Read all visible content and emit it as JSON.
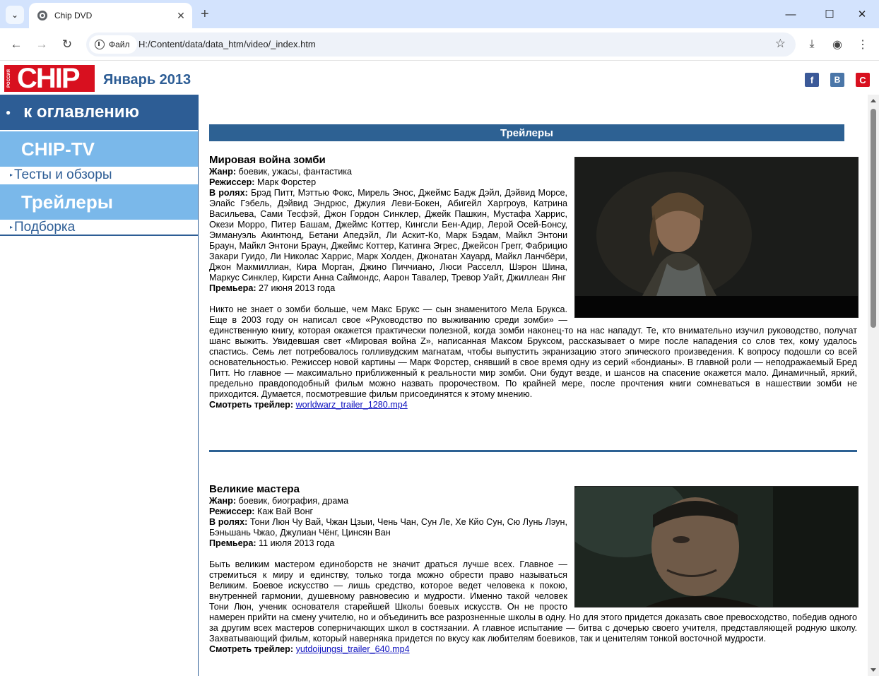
{
  "browser": {
    "tab_title": "Chip DVD",
    "site_chip": "Файл",
    "url": "H:/Content/data/data_htm/video/_index.htm"
  },
  "header": {
    "logo_text": "CHIP",
    "logo_side": "РОССИЯ GO DIGITAL",
    "issue": "Январь 2013",
    "social": [
      "facebook-icon",
      "vk-icon",
      "chip-icon"
    ]
  },
  "sidebar": {
    "toc": "к оглавлению",
    "category1": "CHIP-TV",
    "sub1": "Тесты и обзоры",
    "category2": "Трейлеры",
    "sub2": "Подборка"
  },
  "content": {
    "section_title": "Трейлеры",
    "articles": [
      {
        "title": "Мировая война зомби",
        "genre_label": "Жанр:",
        "genre": "боевик, ужасы, фантастика",
        "director_label": "Режиссер:",
        "director": "Марк Форстер",
        "cast_label": "В ролях:",
        "cast": "Брэд Питт, Мэттью Фокс, Мирель Энос, Джеймс Бадж Дэйл, Дэйвид Морсе, Элайс Гэбель, Дэйвид Эндрюс, Джулия Леви-Бокен, Абигейл Харгроув, Катрина Васильева, Сами Тесфэй, Джон Гордон Синклер, Джейк Пашкин, Мустафа Харрис, Окези Морро, Питер Башам, Джеймс Коттер, Кингсли Бен-Адир, Лерой Осей-Бонсу, Эммануэль Акинтюнд, Бетани Апедэйл, Ли Аскит-Ко, Марк Бэдам, Майкл Энтони Браун, Майкл Энтони Браун, Джеймс Коттер, Катинга Эгрес, Джейсон Грегг, Фабрицио Закари Гуидо, Ли Николас Харрис, Марк Холден, Джонатан Хауард, Майкл Ланчбёри, Джон Макмиллиан, Кира Морган, Джино Пиччиано, Люси Расселл, Шэрон Шина, Маркус Синклер, Кирсти Анна Саймондс, Аарон Тавалер, Тревор Уайт, Джиллеан Янг",
        "premiere_label": "Премьера:",
        "premiere": "27 июня 2013 года",
        "description": "Никто не знает о зомби больше, чем Макс Брукс — сын знаменитого Мела Брукса. Еще в 2003 году он написал свое «Руководство по выживанию среди зомби» — единственную книгу, которая окажется практически полезной, когда зомби наконец-то на нас нападут. Те, кто внимательно изучил руководство, получат шанс выжить. Увидевшая свет «Мировая война Z», написанная Максом Бруксом, рассказывает о мире после нападения со слов тех, кому удалось спастись. Семь лет потребовалось голливудским магнатам, чтобы выпустить экранизацию этого эпического произведения. К вопросу подошли со всей основательностью. Режиссер новой картины — Марк Форстер, снявший в свое время одну из серий «бондианы». В главной роли — неподражаемый Бред Питт. Но главное — максимально приближенный к реальности мир зомби. Они будут везде, и шансов на спасение окажется мало. Динамичный, яркий, предельно правдоподобный фильм можно назвать пророчеством. По крайней мере, после прочтения книги сомневаться в нашествии зомби не приходится. Думается, посмотревшие фильм присоединятся к этому мнению.",
        "trailer_label": "Смотреть трейлер:",
        "trailer_link": "worldwarz_trailer_1280.mp4"
      },
      {
        "title": "Великие мастера",
        "genre_label": "Жанр:",
        "genre": "боевик, биография, драма",
        "director_label": "Режиссер:",
        "director": "Каж Вай Вонг",
        "cast_label": "В ролях:",
        "cast": "Тони Люн Чу Вай, Чжан Цзыи, Чень Чан, Сун Ле, Хе Кйо Сун, Сю Лунь Лэун, Бэньшань Чжао, Джулиан Чёнг, Цинсян Ван",
        "premiere_label": "Премьера:",
        "premiere": "11 июля 2013 года",
        "description": "Быть великим мастером единоборств не значит драться лучше всех. Главное — стремиться к миру и единству, только тогда можно обрести право называться Великим. Боевое искусство — лишь средство, которое ведет человека к покою, внутренней гармонии, душевному равновесию и мудрости. Именно такой человек Тони Люн, ученик основателя старейшей Школы боевых искусств. Он не просто намерен прийти на смену учителю, но и объединить все разрозненные школы в одну. Но для этого придется доказать свое превосходство, победив одного за другим всех мастеров соперничающих школ в состязании. А главное испытание — битва с дочерью своего учителя, представляющей родную школу. Захватывающий фильм, который наверняка придется по вкусу как любителям боевиков, так и ценителям тонкой восточной мудрости.",
        "trailer_label": "Смотреть трейлер:",
        "trailer_link": "yutdoijungsi_trailer_640.mp4"
      }
    ]
  },
  "colors": {
    "nav_dark": "#2d5d95",
    "nav_light": "#7ab8ea",
    "logo_red": "#d8101f",
    "link": "#0b0fbd"
  }
}
